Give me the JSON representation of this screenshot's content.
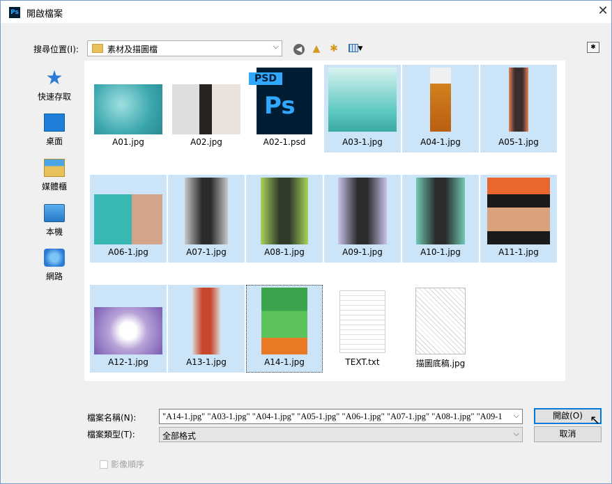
{
  "window": {
    "title": "開啟檔案",
    "app_icon": "Ps",
    "close": "✕"
  },
  "toolbar": {
    "look_in_label": "搜尋位置(I):",
    "look_in_value": "素材及描圖檔"
  },
  "places": [
    {
      "label": "快速存取",
      "icon": "quick-access-icon"
    },
    {
      "label": "桌面",
      "icon": "desktop-icon"
    },
    {
      "label": "媒體櫃",
      "icon": "libraries-icon"
    },
    {
      "label": "本機",
      "icon": "this-pc-icon"
    },
    {
      "label": "網路",
      "icon": "network-icon"
    }
  ],
  "files": [
    {
      "name": "A01.jpg",
      "selected": false
    },
    {
      "name": "A02.jpg",
      "selected": false
    },
    {
      "name": "A02-1.psd",
      "selected": false,
      "badge": "PSD",
      "logo": "Ps"
    },
    {
      "name": "A03-1.jpg",
      "selected": true
    },
    {
      "name": "A04-1.jpg",
      "selected": true
    },
    {
      "name": "A05-1.jpg",
      "selected": true
    },
    {
      "name": "A06-1.jpg",
      "selected": true
    },
    {
      "name": "A07-1.jpg",
      "selected": true
    },
    {
      "name": "A08-1.jpg",
      "selected": true
    },
    {
      "name": "A09-1.jpg",
      "selected": true
    },
    {
      "name": "A10-1.jpg",
      "selected": true
    },
    {
      "name": "A11-1.jpg",
      "selected": true
    },
    {
      "name": "A12-1.jpg",
      "selected": true
    },
    {
      "name": "A13-1.jpg",
      "selected": true
    },
    {
      "name": "A14-1.jpg",
      "selected": true,
      "focused": true
    },
    {
      "name": "TEXT.txt",
      "selected": false
    },
    {
      "name": "描圖底稿.jpg",
      "selected": false
    }
  ],
  "bottom": {
    "file_name_label": "檔案名稱(N):",
    "file_name_value": "\"A14-1.jpg\" \"A03-1.jpg\" \"A04-1.jpg\" \"A05-1.jpg\" \"A06-1.jpg\" \"A07-1.jpg\" \"A08-1.jpg\" \"A09-1",
    "file_type_label": "檔案類型(T):",
    "file_type_value": "全部格式",
    "open_label": "開啟(O)",
    "cancel_label": "取消",
    "sequence_label": "影像順序"
  },
  "colors": {
    "selection": "#cce4f7",
    "accent": "#0078d7"
  }
}
